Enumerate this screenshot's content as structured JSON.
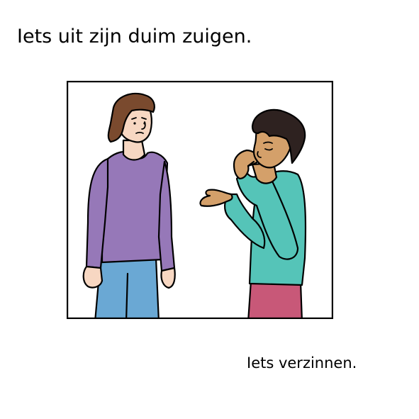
{
  "title": "Iets uit zijn duim zuigen.",
  "caption": "Iets verzinnen.",
  "colors": {
    "frame": "#000000",
    "background": "#ffffff",
    "skin_light": "#f7d7c2",
    "skin_tan": "#d4a06a",
    "hair_brown": "#7a4a2e",
    "hair_dark": "#2e2220",
    "sweater_purple": "#9678b8",
    "pants_blue": "#6aa8d4",
    "sweater_teal": "#55c4b8",
    "pants_pink": "#c85878"
  }
}
